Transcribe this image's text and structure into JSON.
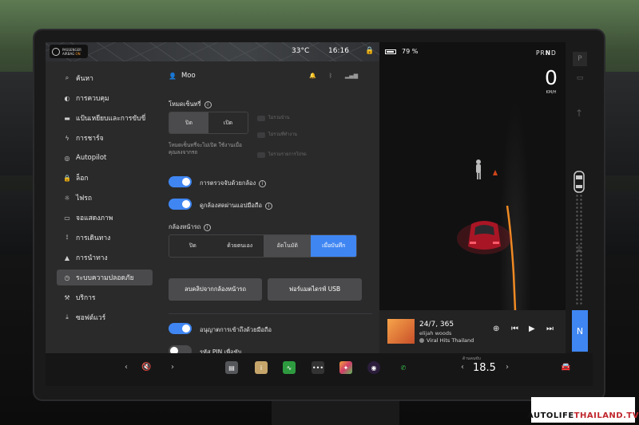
{
  "status": {
    "airbag_line1": "PASSENGER",
    "airbag_line2": "AIRBAG",
    "airbag_state": "ON",
    "temperature": "33°C",
    "time": "16:16",
    "lock_icon": "lock-icon"
  },
  "sidebar": {
    "items": [
      {
        "label": "ค้นหา",
        "icon": "search-icon"
      },
      {
        "label": "การควบคุม",
        "icon": "toggle-icon"
      },
      {
        "label": "แป้นเหยียบและการขับขี่",
        "icon": "car-icon"
      },
      {
        "label": "การชาร์จ",
        "icon": "bolt-icon"
      },
      {
        "label": "Autopilot",
        "icon": "steering-icon"
      },
      {
        "label": "ล็อก",
        "icon": "lock-icon"
      },
      {
        "label": "ไฟรถ",
        "icon": "light-icon"
      },
      {
        "label": "จอแสดงภาพ",
        "icon": "display-icon"
      },
      {
        "label": "การเดินทาง",
        "icon": "trip-icon"
      },
      {
        "label": "การนำทาง",
        "icon": "navigation-icon"
      },
      {
        "label": "ระบบความปลอดภัย",
        "icon": "safety-icon"
      },
      {
        "label": "บริการ",
        "icon": "wrench-icon"
      },
      {
        "label": "ซอฟต์แวร์",
        "icon": "download-icon"
      }
    ],
    "active_index": 10
  },
  "panel": {
    "user_name": "Moo",
    "sentry": {
      "title": "โหมดเซ็นทรี่",
      "options": [
        "ปิด",
        "เปิด"
      ],
      "selected": "ปิด",
      "description_line1": "โหมดเซ็นทรี่จะไม่เปิด ใช้งานเมื่อ",
      "description_line2": "คุณลงจากรถ",
      "disabled_options": [
        "ไม่รวมบ้าน",
        "ไม่รวมที่ทำงาน",
        "ไม่รวมรายการโปรด"
      ]
    },
    "camera_detection": {
      "label": "การตรวจจับด้วยกล้อง",
      "on": true
    },
    "live_view": {
      "label": "ดูกล้องสดผ่านแอปมือถือ",
      "on": true
    },
    "dashcam": {
      "title": "กล้องหน้ารถ",
      "options": [
        "ปิด",
        "ด้วยตนเอง",
        "อัตโนมัติ",
        "เมื่อบันทึก"
      ],
      "selected": "อัตโนมัติ",
      "highlighted": "เมื่อบันทึก"
    },
    "buttons": {
      "delete_clips": "ลบคลิปจากกล้องหน้ารถ",
      "format_usb": "ฟอร์แมตไดรฟ์ USB"
    },
    "phone_access": {
      "label": "อนุญาตการเข้าถึงด้วยมือถือ",
      "on": true
    },
    "pin": {
      "label": "รหัส PIN เพื่อขับ",
      "on": false
    }
  },
  "viz": {
    "battery": "79 %",
    "gears": [
      "P",
      "R",
      "N",
      "D"
    ],
    "active_gear": "N",
    "speed": "0",
    "unit": "KM/H"
  },
  "rightstrip": {
    "park": "P",
    "neutral": "N"
  },
  "media": {
    "title": "24/7, 365",
    "artist": "elijah woods",
    "source": "Viral Hits Thailand"
  },
  "bottom": {
    "cabin_label": "ด้านคนขับ",
    "temperature": "18.5"
  },
  "watermark": {
    "brand": "AUTOLIFE",
    "brand2": "THAILAND.TV"
  }
}
